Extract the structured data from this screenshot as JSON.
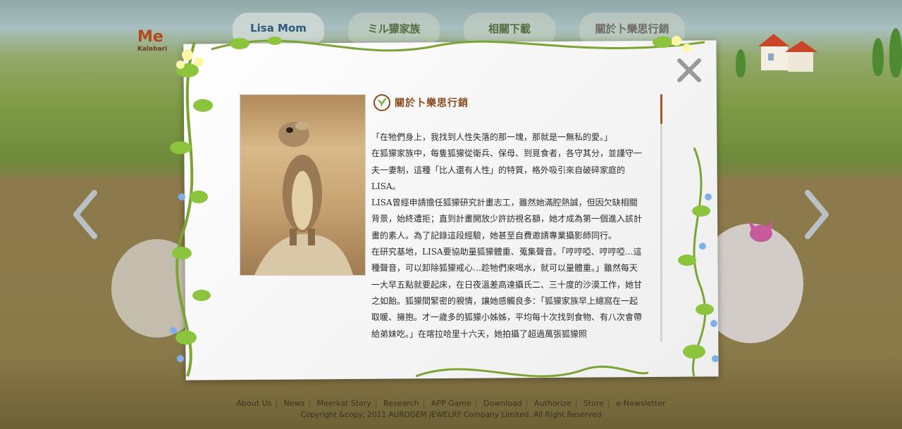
{
  "nav": {
    "tabs": [
      "Lisa Mom",
      "ミル獴家族",
      "相關下載",
      "關於卜樂思行銷"
    ],
    "active_index": 0
  },
  "logo": {
    "text": "Me",
    "subtext": "Kalahari"
  },
  "modal": {
    "title": "關於卜樂思行銷",
    "paragraphs": [
      "「在牠們身上，我找到人性失落的那一塊，那就是一無私的愛。」",
      "在狐獴家族中，每隻狐獴從衛兵、保母、到覓食者，各守其分，並謹守一夫一妻制，這種「比人還有人性」的特質，格外吸引來自破碎家庭的LISA。",
      "LISA曾經申請擔任狐獴研究計畫志工，雖然她滿腔熱誠，但因欠缺相關背景，始終遭拒；直到計畫開放少許訪視名額，她才成為第一個進入該計畫的素人。為了記錄這段經驗，她甚至自費邀請專業攝影師同行。",
      "在研究基地，LISA要協助量狐獴體重、蒐集聲音。「哼哼啞、哼哼啞…這種聲音，可以卸除狐獴戒心…趁牠們來喝水，就可以量體重。」雖然每天一大早五點就要起床，在日夜溫差高達攝氏二、三十度的沙漠工作，她甘之如飴。狐獴間緊密的親情，讓她感觸良多：「狐獴家族早上總窩在一起取暖、擁抱。才一歲多的狐獴小姊姊，平均每十次找到食物、有八次會帶給弟妹吃。」在喀拉哈里十六天，她拍攝了超過萬張狐獴照"
    ]
  },
  "footer": {
    "links": [
      "About Us",
      "News",
      "Meerkat Story",
      "Research",
      "APP Game",
      "Download",
      "Authorize",
      "Store",
      "e-Newsletter"
    ],
    "copyright": "Copyright &copy; 2011 AUROGEM JEWELRY Company Limited. All Right Reserved"
  },
  "colors": {
    "title": "#8a4a1e",
    "scroll_thumb": "#a9562c",
    "active_tab": "#2e5a7a"
  }
}
